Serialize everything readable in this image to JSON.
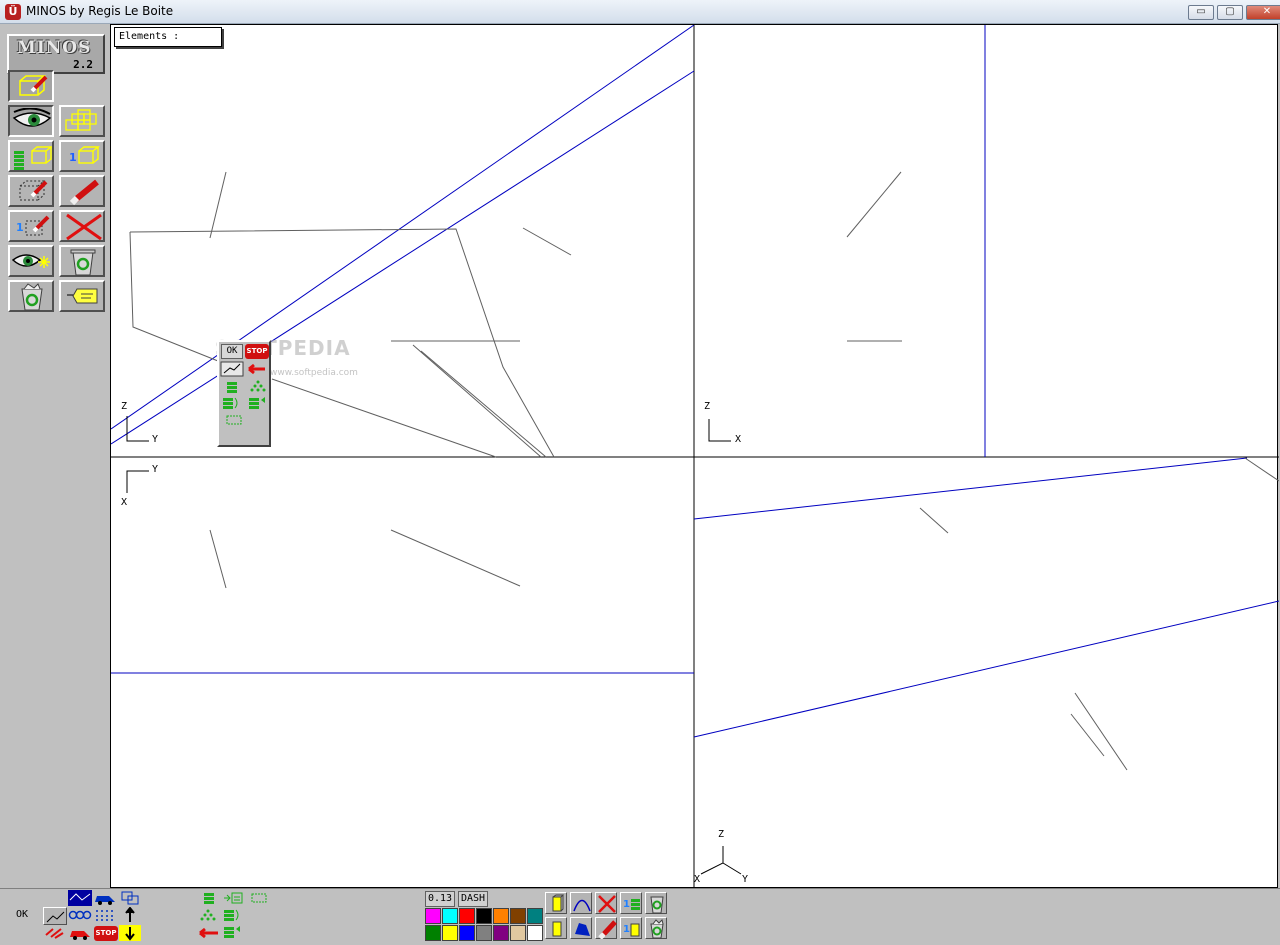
{
  "window": {
    "title": "MINOS by Regis Le Boite",
    "minimize_glyph": "▭",
    "maximize_glyph": "▢",
    "close_glyph": "✕"
  },
  "logo": {
    "name": "MINOS",
    "version": "2.2"
  },
  "left_toolbar": {
    "tools": [
      {
        "name": "edit-cube-icon"
      },
      {
        "name": "eye-icon"
      },
      {
        "name": "multi-cube-icon"
      },
      {
        "name": "layers-cube-icon"
      },
      {
        "name": "one-cube-icon"
      },
      {
        "name": "erase-dotted-cube-icon"
      },
      {
        "name": "eraser-icon"
      },
      {
        "name": "one-erase-cube-icon"
      },
      {
        "name": "delete-x-icon"
      },
      {
        "name": "eye-spark-icon"
      },
      {
        "name": "recycle-bin-icon"
      },
      {
        "name": "recycle-bin-open-icon"
      },
      {
        "name": "tag-icon"
      }
    ]
  },
  "elements_box": {
    "label": "Elements :"
  },
  "axes": {
    "top_left": {
      "vertical": "Z",
      "horizontal": "Y"
    },
    "top_right": {
      "vertical": "Z",
      "horizontal": "X"
    },
    "bottom_left": {
      "vertical": "X",
      "horizontal": "Y"
    },
    "bottom_right": {
      "vertical": "Z",
      "left": "X",
      "right": "Y"
    }
  },
  "popup": {
    "ok_label": "OK",
    "stop_label": "STOP"
  },
  "watermark": {
    "text": "SOFTPEDIA",
    "sub": "www.softpedia.com"
  },
  "bottom_bar": {
    "ok_label": "OK",
    "line_width": "0.13",
    "line_style": "DASH",
    "stop_label": "STOP",
    "palette_row1": [
      "#ff00ff",
      "#00ffff",
      "#ff0000",
      "#000000",
      "#ff8000",
      "#804000",
      "#008080"
    ],
    "palette_row2": [
      "#008000",
      "#ffff00",
      "#0000ff",
      "#808080",
      "#800080",
      "#e0c8a0",
      "#ffffff"
    ]
  },
  "colors": {
    "accent_line": "#0000c0",
    "geometry_line": "#505050"
  }
}
